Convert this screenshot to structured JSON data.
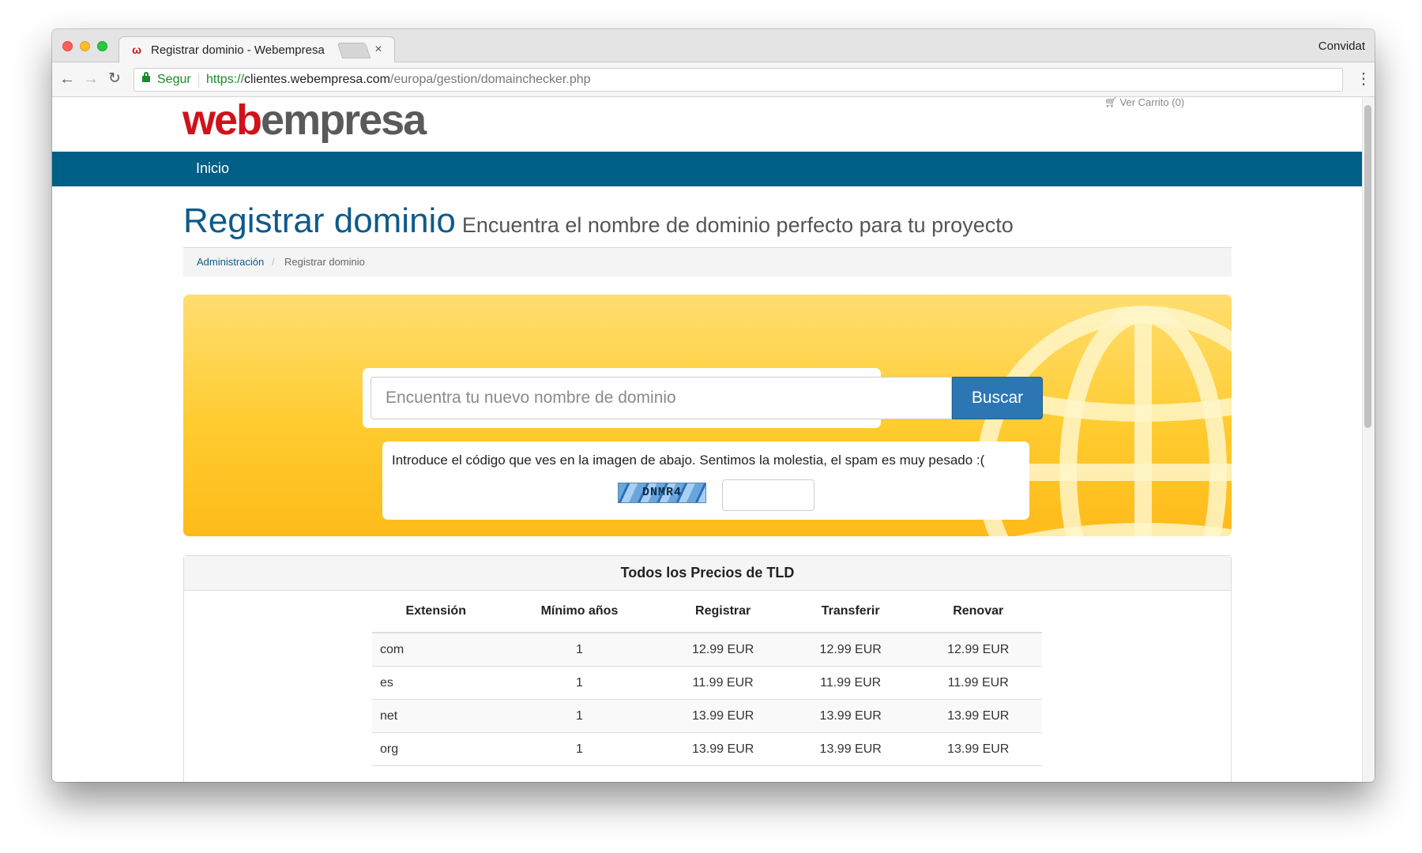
{
  "browser": {
    "tab_title": "Registrar dominio - Webempresa",
    "tab_close": "×",
    "guest_label": "Convidat",
    "secure_label": "Segur",
    "url_scheme": "https://",
    "url_host": "clientes.webempresa.com",
    "url_path": "/europa/gestion/domainchecker.php",
    "icons": {
      "back": "arrow-left-icon",
      "forward": "arrow-right-icon",
      "reload": "reload-icon",
      "lock": "lock-icon",
      "menu": "kebab-menu-icon"
    }
  },
  "header": {
    "logo_part1": "web",
    "logo_part2": "empresa",
    "cart_label": "Ver Carrito (0)"
  },
  "nav": {
    "home_label": "Inicio"
  },
  "page": {
    "title": "Registrar dominio",
    "subtitle": "Encuentra el nombre de dominio perfecto para tu proyecto",
    "breadcrumb": {
      "parent": "Administración",
      "separator": "/",
      "current": "Registrar dominio"
    }
  },
  "search": {
    "placeholder": "Encuentra tu nuevo nombre de dominio",
    "button_label": "Buscar",
    "captcha_text": "Introduce el código que ves en la imagen de abajo. Sentimos la molestia, el spam es muy pesado :(",
    "captcha_code": "DNMR4"
  },
  "prices": {
    "heading": "Todos los Precios de TLD",
    "columns": [
      "Extensión",
      "Mínimo años",
      "Registrar",
      "Transferir",
      "Renovar"
    ],
    "rows": [
      {
        "ext": "com",
        "min_years": "1",
        "register": "12.99 EUR",
        "transfer": "12.99 EUR",
        "renew": "12.99 EUR"
      },
      {
        "ext": "es",
        "min_years": "1",
        "register": "11.99 EUR",
        "transfer": "11.99 EUR",
        "renew": "11.99 EUR"
      },
      {
        "ext": "net",
        "min_years": "1",
        "register": "13.99 EUR",
        "transfer": "13.99 EUR",
        "renew": "13.99 EUR"
      },
      {
        "ext": "org",
        "min_years": "1",
        "register": "13.99 EUR",
        "transfer": "13.99 EUR",
        "renew": "13.99 EUR"
      }
    ]
  },
  "colors": {
    "brand_red": "#d0121b",
    "nav_blue": "#005f86",
    "title_blue": "#0e5a8a",
    "button_blue": "#2d76b4",
    "hero_yellow": "#ffcb2f"
  }
}
